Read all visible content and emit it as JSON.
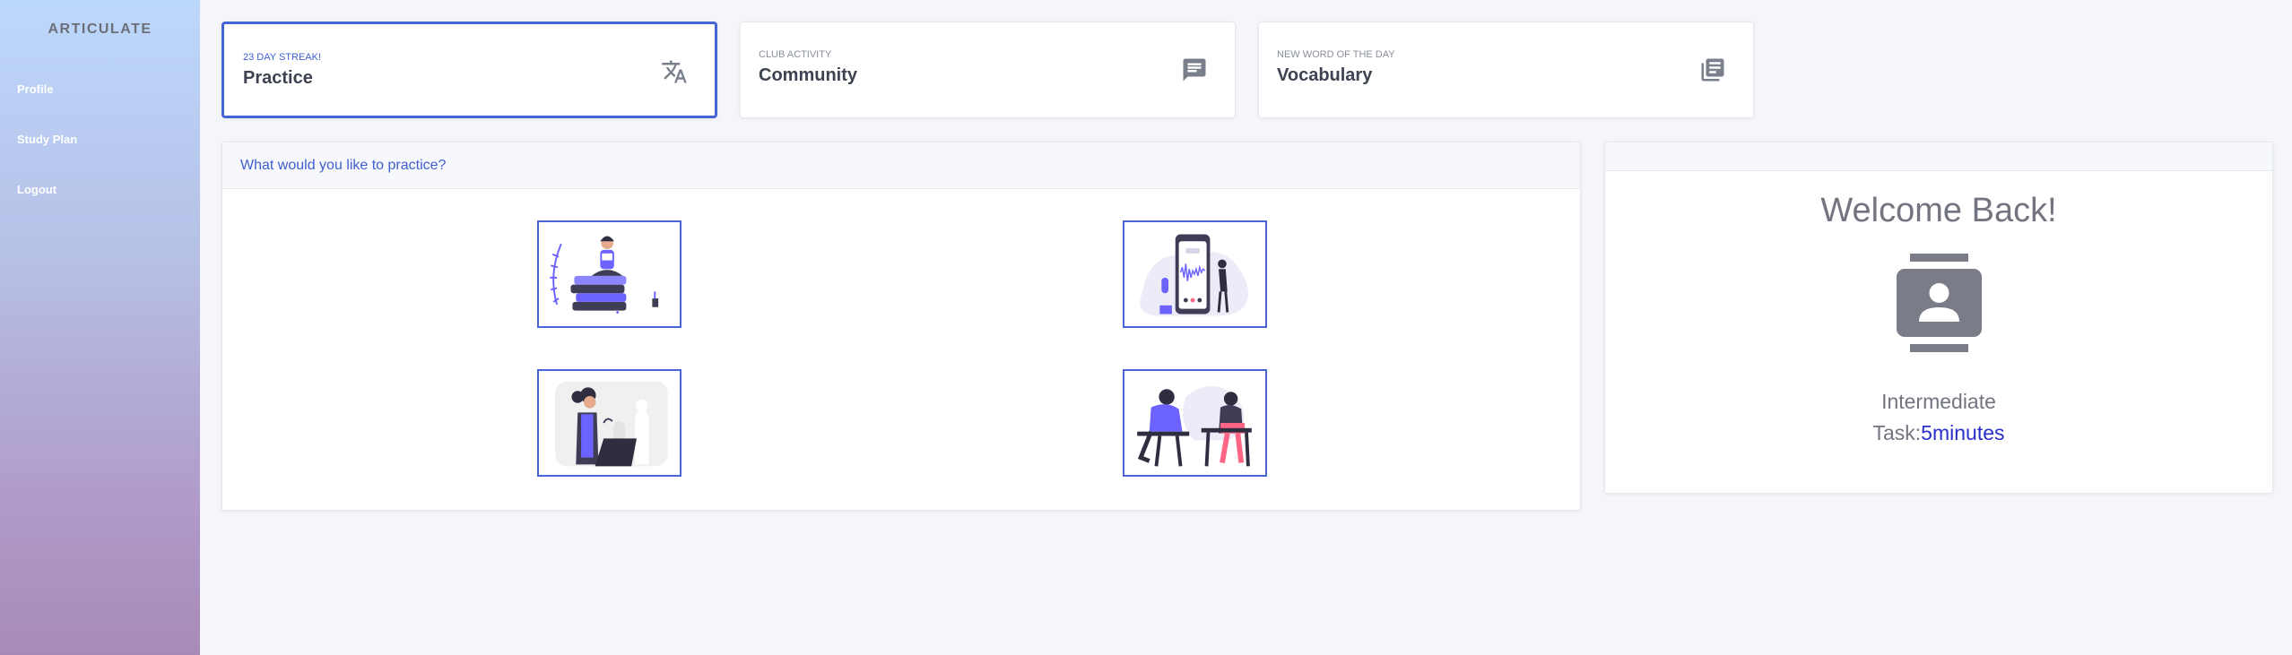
{
  "app": {
    "brand": "ARTICULATE"
  },
  "sidebar": {
    "items": [
      {
        "label": "Profile"
      },
      {
        "label": "Study Plan"
      },
      {
        "label": "Logout"
      }
    ]
  },
  "cards": [
    {
      "kicker": "23 DAY STREAK!",
      "title": "Practice",
      "icon": "translate-icon",
      "active": true
    },
    {
      "kicker": "CLUB ACTIVITY",
      "title": "Community",
      "icon": "chat-icon",
      "active": false
    },
    {
      "kicker": "NEW WORD OF THE DAY",
      "title": "Vocabulary",
      "icon": "library-books-icon",
      "active": false
    }
  ],
  "practice": {
    "header": "What would you like to practice?",
    "tiles": [
      {
        "icon": "reading-illustration"
      },
      {
        "icon": "listening-phone-illustration"
      },
      {
        "icon": "speaking-podium-illustration"
      },
      {
        "icon": "writing-desk-illustration"
      }
    ]
  },
  "welcome": {
    "title": "Welcome Back!",
    "icon": "contact-card-icon",
    "level": "Intermediate",
    "task_label": "Task:",
    "task_value": "5minutes"
  },
  "colors": {
    "accent": "#4466d4",
    "task_value": "#2a2fc7",
    "sidebar_top": "#bcd8fb",
    "sidebar_bottom": "#a88ab8",
    "illustration_purple": "#6c63ff"
  }
}
